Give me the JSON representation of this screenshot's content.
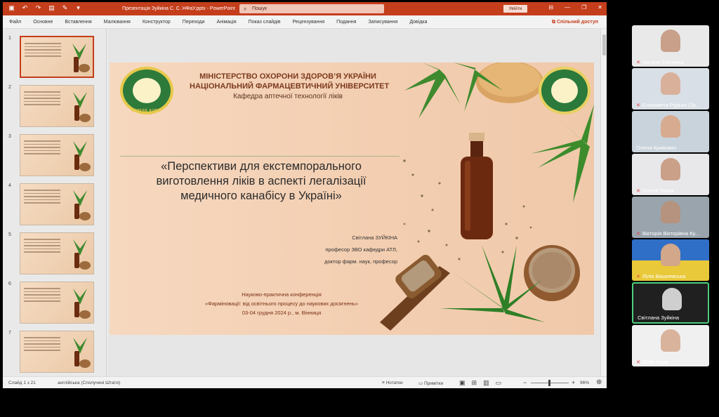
{
  "ppt": {
    "document_title": "Презентація Зуйкіна С. С. НФаУ.pptx  -  PowerPoint",
    "search_placeholder": "Пошук",
    "signin_label": "Увійти",
    "ribbon_tabs": [
      "Файл",
      "Основне",
      "Вставлення",
      "Малювання",
      "Конструктор",
      "Переходи",
      "Анімація",
      "Показ слайдів",
      "Рецензування",
      "Подання",
      "Записування",
      "Довідка"
    ],
    "share_label": "Спільний доступ",
    "thumbnails": [
      {
        "num": "1",
        "active": true
      },
      {
        "num": "2",
        "active": false
      },
      {
        "num": "3",
        "active": false
      },
      {
        "num": "4",
        "active": false
      },
      {
        "num": "5",
        "active": false
      },
      {
        "num": "6",
        "active": false
      },
      {
        "num": "7",
        "active": false
      }
    ],
    "status": {
      "slide_counter": "Слайд 1 з 21",
      "language": "англійська (Сполучені Штати)",
      "notes_label": "Нотатки",
      "comments_label": "Примітки",
      "zoom": "96%"
    }
  },
  "slide": {
    "header_line1": "МІНІСТЕРСТВО ОХОРОНИ ЗДОРОВ’Я УКРАЇНИ",
    "header_line2": "НАЦІОНАЛЬНИЙ ФАРМАЦЕВТИЧНИЙ УНІВЕРСИТЕТ",
    "header_line3": "Кафедра аптечної технології ліків",
    "seal_left_caption": "SAPERE   AUDE",
    "title_line1": "«Перспективи для екстемпорального",
    "title_line2": "виготовлення ліків в аспекті легалізації",
    "title_line3": "медичного канабісу в Україні»",
    "author_name": "Світлана ЗУЙКІНА",
    "author_position": "професор ЗВО кафедри АТЛ,",
    "author_degree": "доктор фарм. наук, професор",
    "conf_line1": "Науково-практична конференція",
    "conf_line2": "«Фарміновації: від освітнього процесу до наукових досягнень»",
    "conf_line3": "03-04 грудня 2024 р., м. Вінниця"
  },
  "participants": [
    {
      "name": "Наталя Ткаченко",
      "muted": true
    },
    {
      "name": "Єлизавета Рудько (Зу...",
      "muted": true
    },
    {
      "name": "Олена Кривовяз",
      "muted": false
    },
    {
      "name": "Олена Тозюк",
      "muted": true
    },
    {
      "name": "Вікторія Вікторівна Ку...",
      "muted": true
    },
    {
      "name": "Лілія Вишневська",
      "muted": true
    },
    {
      "name": "Світлана Зуйкіна",
      "muted": false,
      "speaking": true
    },
    {
      "name": "Юлія Корж",
      "muted": true
    }
  ],
  "colors": {
    "ppt_accent": "#c43e1c",
    "speaking_border": "#4ccf7c",
    "slide_title_dark": "#7d3a1e"
  }
}
